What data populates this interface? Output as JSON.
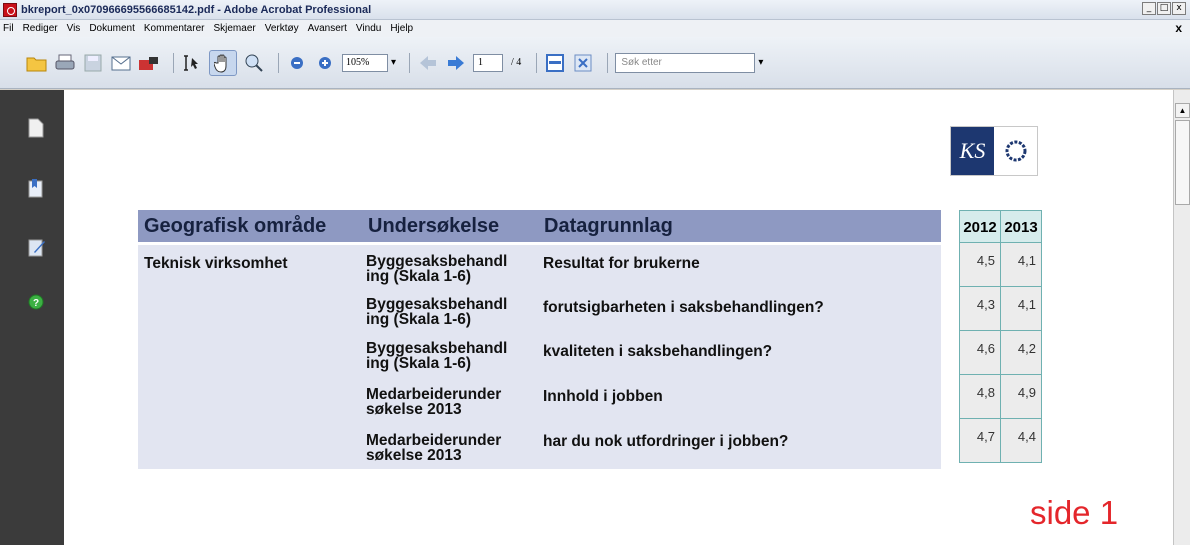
{
  "window": {
    "title": "bkreport_0x070966695566685142.pdf - Adobe Acrobat Professional",
    "controls": {
      "minimize": "_",
      "maximize": "□",
      "close": "x"
    }
  },
  "menu": {
    "items": [
      "Fil",
      "Rediger",
      "Vis",
      "Dokument",
      "Kommentarer",
      "Skjemaer",
      "Verktøy",
      "Avansert",
      "Vindu",
      "Hjelp"
    ],
    "close": "x"
  },
  "toolbar": {
    "zoom": "105%",
    "zoom_arrow": "▾",
    "page_current": "1",
    "page_total": "/ 4",
    "search_placeholder": "Søk etter",
    "search_arrow": "▾"
  },
  "scrollbar": {
    "up_arrow": "▲"
  },
  "document": {
    "logo_text": "KS",
    "headers": {
      "area": "Geografisk område",
      "survey": "Undersøkelse",
      "basis": "Datagrunnlag"
    },
    "years": [
      "2012",
      "2013"
    ],
    "area_value": "Teknisk virksomhet",
    "rows": [
      {
        "survey_l1": "Byggesaksbehandl",
        "survey_l2": "ing (Skala 1-6)",
        "basis": "Resultat for brukerne",
        "v2012": "4,5",
        "v2013": "4,1"
      },
      {
        "survey_l1": "Byggesaksbehandl",
        "survey_l2": "ing (Skala 1-6)",
        "basis": "forutsigbarheten i saksbehandlingen?",
        "v2012": "4,3",
        "v2013": "4,1"
      },
      {
        "survey_l1": "Byggesaksbehandl",
        "survey_l2": "ing (Skala 1-6)",
        "basis": "kvaliteten i saksbehandlingen?",
        "v2012": "4,6",
        "v2013": "4,2"
      },
      {
        "survey_l1": "Medarbeiderunder",
        "survey_l2": "søkelse 2013",
        "basis": "Innhold i jobben",
        "v2012": "4,8",
        "v2013": "4,9"
      },
      {
        "survey_l1": "Medarbeiderunder",
        "survey_l2": "søkelse 2013",
        "basis": "har du nok utfordringer i jobben?",
        "v2012": "4,7",
        "v2013": "4,4"
      }
    ],
    "page_label": "side 1"
  }
}
